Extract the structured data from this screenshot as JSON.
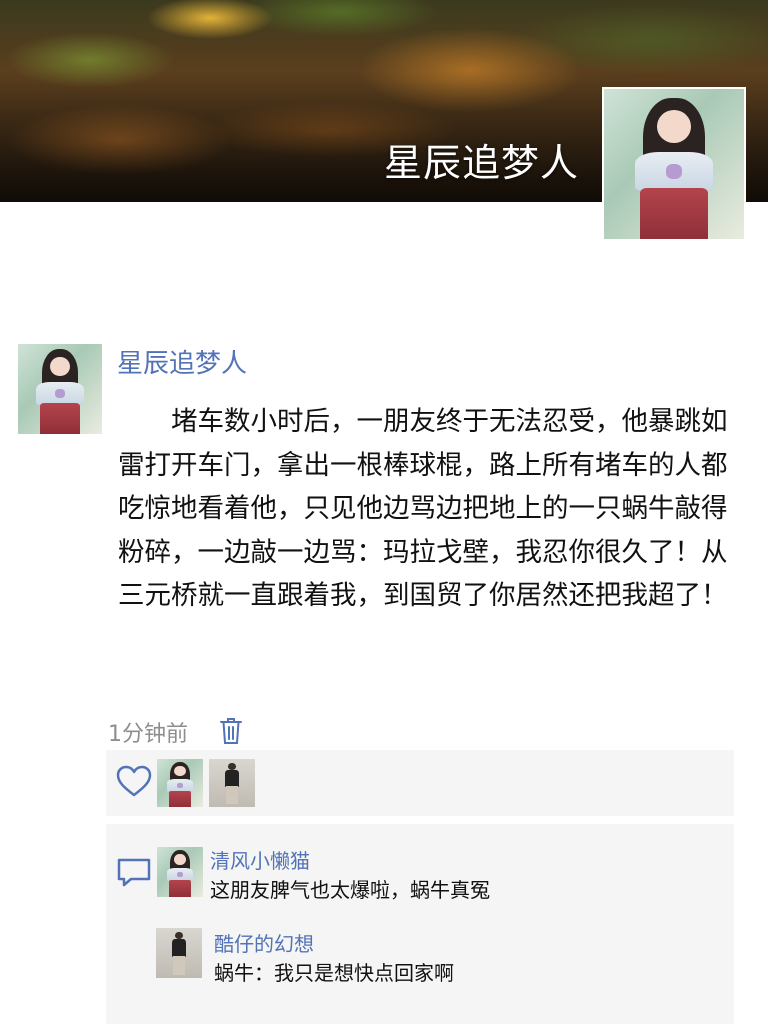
{
  "profile": {
    "cover_name": "星辰追梦人"
  },
  "post": {
    "author": "星辰追梦人",
    "content": "堵车数小时后，一朋友终于无法忍受，他暴跳如雷打开车门，拿出一根棒球棍，路上所有堵车的人都吃惊地看着他，只见他边骂边把地上的一只蜗牛敲得粉碎，一边敲一边骂：玛拉戈壁，我忍你很久了！从三元桥就一直跟着我，到国贸了你居然还把我超了！",
    "time": "1分钟前"
  },
  "likes": {
    "icon": "heart-icon",
    "avatars": [
      "avatar-girl",
      "avatar-man"
    ]
  },
  "comments": [
    {
      "name": "清风小懒猫",
      "text": "这朋友脾气也太爆啦，蜗牛真冤"
    },
    {
      "name": "酷仔的幻想",
      "text": "蜗牛：我只是想快点回家啊"
    }
  ],
  "colors": {
    "name_blue": "#5273b7",
    "time_gray": "#8e8e8e",
    "panel_bg": "#f5f5f5"
  }
}
